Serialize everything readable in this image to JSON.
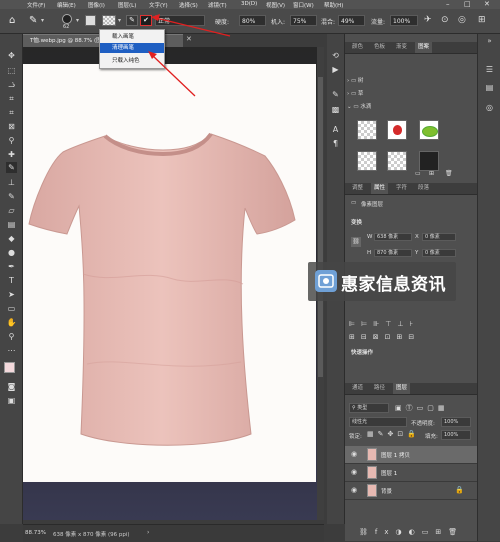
{
  "menu": [
    "文件(F)",
    "编辑(E)",
    "图像(I)",
    "图层(L)",
    "文字(Y)",
    "选择(S)",
    "滤镜(T)",
    "3D(D)",
    "视图(V)",
    "窗口(W)",
    "帮助(H)"
  ],
  "options": {
    "brush_size": "62",
    "mode_value": "正常",
    "opacity_label": "硬度:",
    "opacity_value": "80%",
    "flow_label": "机入:",
    "flow_value": "75%",
    "mix_label": "混合:",
    "mix_value": "49%",
    "amount_label": "流量:",
    "amount_value": "100%"
  },
  "popup": {
    "items": [
      "载入画笔",
      "清理画笔",
      "只载入纯色"
    ],
    "selected_index": 1
  },
  "document": {
    "tab_title": "T恤.webp.jpg @ 88.7% (图层",
    "zoom": "88.73%",
    "size": "638 像素 x 870 像素 (96 ppi)"
  },
  "panels": {
    "top_tabs": [
      "颜色",
      "色板",
      "渐变",
      "图案"
    ],
    "pattern_groups": [
      "树",
      "草",
      "水滴"
    ],
    "props_tabs": [
      "调整",
      "属性",
      "字符",
      "段落"
    ],
    "props_subtitle": "像素图层",
    "transform_label": "变换",
    "w_label": "W",
    "w_value": "638 像素",
    "h_label": "H",
    "h_value": "870 像素",
    "x_label": "X",
    "x_value": "0 像素",
    "y_label": "Y",
    "y_value": "0 像素",
    "quick_actions": "快速操作",
    "layers_tabs": [
      "通道",
      "路径",
      "图层"
    ],
    "kind_label": "类型",
    "blend_mode": "线性光",
    "opacity_label": "不透明度:",
    "opacity_value": "100%",
    "lock_label": "锁定:",
    "fill_label": "填充:",
    "fill_value": "100%",
    "layers": [
      {
        "name": "图层 1 拷贝",
        "selected": true
      },
      {
        "name": "图层 1",
        "selected": false
      },
      {
        "name": "背景",
        "selected": false
      }
    ]
  },
  "watermark": {
    "text": "惠家信息资讯"
  },
  "colors": {
    "accent_blue": "#1f5fc2",
    "arrow_red": "#e02020",
    "shirt": "#e7b9b2"
  }
}
